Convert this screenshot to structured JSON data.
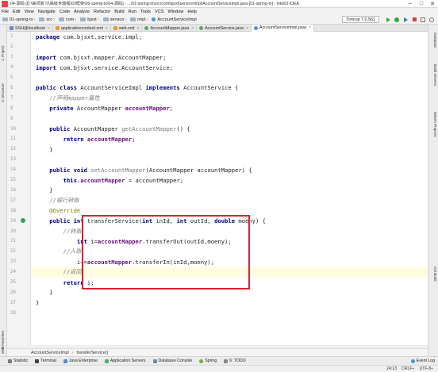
{
  "window": {
    "title": "04-源码 [D:\\高项复习\\高级专题程\\03框架\\06-spring-tx\\04-源码] - ...\\01-spring-tx\\src\\com\\bjsxt\\service\\impl\\AccountServiceImpl.java [01-spring-tx] - IntelliJ IDEA",
    "minimize": "–",
    "maximize": "□",
    "close": "✕"
  },
  "menu": [
    "File",
    "Edit",
    "View",
    "Navigate",
    "Code",
    "Analyze",
    "Refactor",
    "Build",
    "Run",
    "Tools",
    "VCS",
    "Window",
    "Help"
  ],
  "breadcrumb": [
    "01-spring-tx",
    "src",
    "com",
    "bjsxt",
    "service",
    "impl",
    "AccountServiceImpl"
  ],
  "run_config": "Tomcat 7.0.561",
  "editor_tabs": [
    {
      "label": "SSH@localhost",
      "color": "#6a8db5",
      "active": false
    },
    {
      "label": "applicationcontext.xml",
      "color": "#e39b3b",
      "active": false
    },
    {
      "label": "web.xml",
      "color": "#e39b3b",
      "active": false
    },
    {
      "label": "AccountMapper.java",
      "color": "#59a869",
      "active": false
    },
    {
      "label": "AccountService.java",
      "color": "#59a869",
      "active": false
    },
    {
      "label": "AccountServiceImpl.java",
      "color": "#4a90d9",
      "active": true
    }
  ],
  "tab_close": "×",
  "left_tools": [
    "1: Project",
    "2: Structure",
    "2: Favorites",
    "Web"
  ],
  "right_tools": [
    "Database",
    "Build Servers",
    "Maven Projects",
    "Ant Build"
  ],
  "line_numbers": [
    "1",
    "2",
    "3",
    "4",
    "5",
    "6",
    "7",
    "8",
    "9",
    "10",
    "11",
    "12",
    "13",
    "14",
    "15",
    "16",
    "17",
    "18",
    "19",
    "20",
    "21",
    "22",
    "23",
    "24",
    "25",
    "26",
    "27",
    "28"
  ],
  "code": {
    "l1_kw": "package",
    "l1_rest": " com.bjsxt.service.impl;",
    "l3_kw": "import",
    "l3_rest": " com.bjsxt.mapper.AccountMapper;",
    "l4_kw": "import",
    "l4_rest": " com.bjsxt.service.AccountService;",
    "l6_kw1": "public class",
    "l6_name": " AccountServiceImpl ",
    "l6_kw2": "implements",
    "l6_rest": " AccountService {",
    "l7_cmt": "    //声明mapper属性",
    "l8_kw": "    private",
    "l8_type": " AccountMapper ",
    "l8_fld": "accountMapper",
    "l8_end": ";",
    "l10_kw": "    public",
    "l10_type": " AccountMapper ",
    "l10_mth": "getAccountMapper",
    "l10_end": "() {",
    "l11_kw": "        return",
    "l11_fld": " accountMapper",
    "l11_end": ";",
    "l12": "    }",
    "l14_kw": "    public void",
    "l14_mth": " setAccountMapper",
    "l14_end": "(AccountMapper accountMapper) {",
    "l15_kw": "        this",
    "l15_fld": ".accountMapper",
    "l15_end": " = accountMapper;",
    "l16": "    }",
    "l17_cmt": "    //银行转账",
    "l18_ann": "    @Override",
    "l19_kw1": "    public int",
    "l19_mth": " transferService",
    "l19_p1": "(",
    "l19_kw2": "int",
    "l19_p2": " inId, ",
    "l19_kw3": "int",
    "l19_p3": " outId, ",
    "l19_kw4": "double",
    "l19_p4": " moeny) {",
    "l20_cmt": "        //转账",
    "l21_kw": "            int",
    "l21_a": " i=",
    "l21_fld": "accountMapper",
    "l21_b": ".transferOut(outId,moeny);",
    "l22_cmt": "        //入账",
    "l23_a": "            i+=",
    "l23_fld": "accountMapper",
    "l23_b": ".transferIn(inId,moeny);",
    "l24_cmt": "        //返回",
    "l25_kw": "        return",
    "l25_rest": " i;",
    "l26": "    }",
    "l27": "}"
  },
  "code_breadcrumb": [
    "AccountServiceImpl",
    "transferService()"
  ],
  "tool_windows": [
    {
      "label": "Statistic",
      "color": "#7a7a7a"
    },
    {
      "label": "Terminal",
      "color": "#444444"
    },
    {
      "label": "Java Enterprise",
      "color": "#4a90d9"
    },
    {
      "label": "Application Servers",
      "color": "#59a869"
    },
    {
      "label": "Database Console",
      "color": "#6a8db5"
    },
    {
      "label": "Spring",
      "color": "#6db33f"
    },
    {
      "label": "6: TODO",
      "color": "#888888"
    }
  ],
  "event_log": "Event Log",
  "status": {
    "position": "24:13",
    "line_sep": "CRLF÷",
    "encoding": "UTF-8÷"
  }
}
